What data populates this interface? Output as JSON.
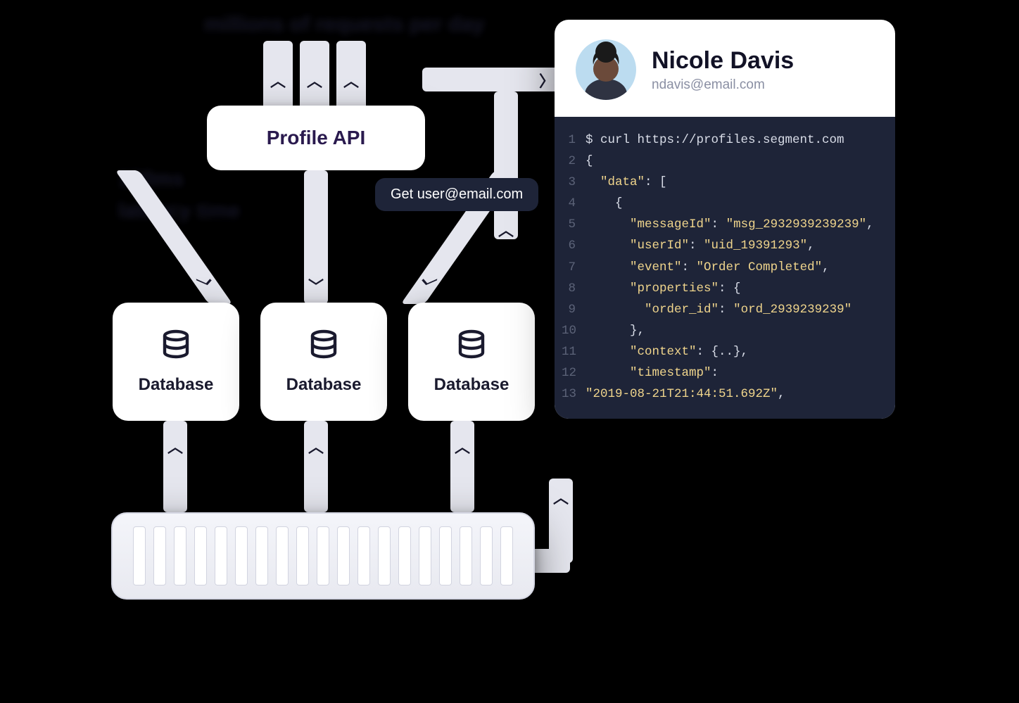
{
  "diagram": {
    "top_blur_label": "millions of requests per day",
    "side_blur_label_line1": "100ms",
    "side_blur_label_line2": "latency time",
    "profile_api_label": "Profile API",
    "get_pill_label": "Get user@email.com",
    "database_label": "Database"
  },
  "profile_card": {
    "user_name": "Nicole Davis",
    "user_email": "ndavis@email.com"
  },
  "code": {
    "lines": [
      {
        "n": "1",
        "text": "$ curl https://profiles.segment.com"
      },
      {
        "n": "2",
        "text": "{"
      },
      {
        "n": "3",
        "text": "  \"data\": ["
      },
      {
        "n": "4",
        "text": "    {"
      },
      {
        "n": "5",
        "text": "      \"messageId\": \"msg_2932939239239\","
      },
      {
        "n": "6",
        "text": "      \"userId\": \"uid_19391293\","
      },
      {
        "n": "7",
        "text": "      \"event\": \"Order Completed\","
      },
      {
        "n": "8",
        "text": "      \"properties\": {"
      },
      {
        "n": "9",
        "text": "        \"order_id\": \"ord_2939239239\""
      },
      {
        "n": "10",
        "text": "      },"
      },
      {
        "n": "11",
        "text": "      \"context\": {..},"
      },
      {
        "n": "12",
        "text": "      \"timestamp\":"
      },
      {
        "n": "13",
        "text": "\"2019-08-21T21:44:51.692Z\","
      }
    ]
  }
}
